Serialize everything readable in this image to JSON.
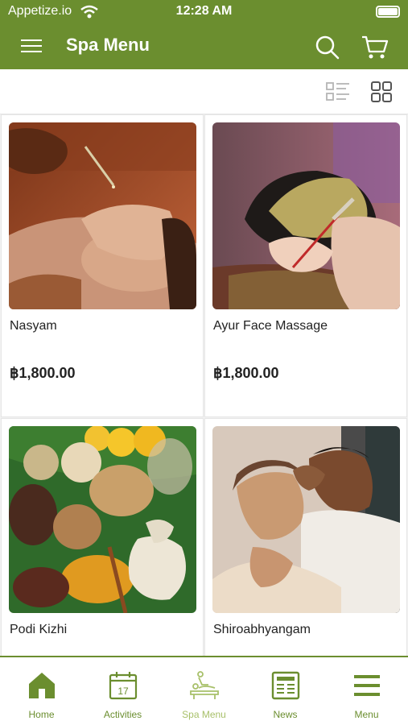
{
  "status_bar": {
    "carrier": "Appetize.io",
    "time": "12:28 AM"
  },
  "header": {
    "title": "Spa Menu"
  },
  "colors": {
    "brand": "#6b8e2f",
    "active_tab": "#a8c06a"
  },
  "products": [
    {
      "name": "Nasyam",
      "price": "฿1,800.00",
      "image": "oil-drop-nasal-treatment"
    },
    {
      "name": "Ayur Face Massage",
      "price": "฿1,800.00",
      "image": "herbal-face-mask"
    },
    {
      "name": "Podi Kizhi",
      "price": "",
      "image": "herbs-and-spices-on-leaf"
    },
    {
      "name": "Shiroabhyangam",
      "price": "",
      "image": "head-massage"
    }
  ],
  "tabs": [
    {
      "label": "Home",
      "icon": "home-icon",
      "active": false
    },
    {
      "label": "Activities",
      "icon": "calendar-icon",
      "active": false
    },
    {
      "label": "Spa Menu",
      "icon": "spa-massage-icon",
      "active": true
    },
    {
      "label": "News",
      "icon": "newspaper-icon",
      "active": false
    },
    {
      "label": "Menu",
      "icon": "hamburger-icon",
      "active": false
    }
  ],
  "calendar_day": "17"
}
